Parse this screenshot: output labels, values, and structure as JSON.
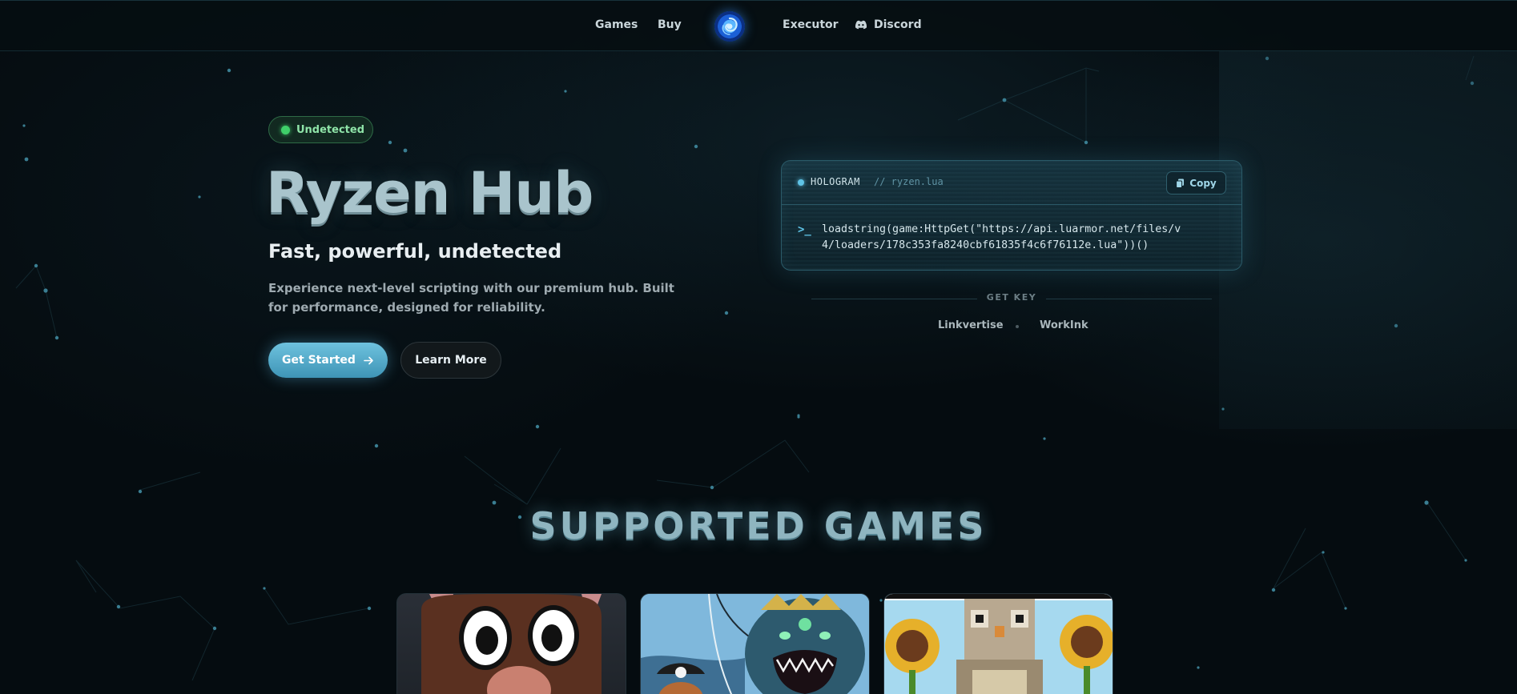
{
  "nav": {
    "games": "Games",
    "buy": "Buy",
    "executor": "Executor",
    "discord": "Discord",
    "logo_icon": "ryzen-swirl-logo"
  },
  "hero": {
    "badge": "Undetected",
    "title": "Ryzen Hub",
    "subtitle": "Fast, powerful, undetected",
    "description": "Experience next-level scripting with our premium hub. Built for performance, designed for reliability.",
    "primary_button": "Get Started",
    "secondary_button": "Learn More"
  },
  "code": {
    "tag": "HOLOGRAM",
    "file": "// ryzen.lua",
    "copy": "Copy",
    "prompt": ">_",
    "line1": "loadstring(game:HttpGet(\"https://api.luarmor.net/files/v",
    "line2": "4/loaders/178c353fa8240cbf61835f4c6f76112e.lua\"))()"
  },
  "getkey": {
    "label": "GET KEY",
    "links": [
      "Linkvertise",
      "WorkInk"
    ]
  },
  "games": {
    "title": "SUPPORTED GAMES",
    "cards": [
      {
        "image": "cartoon-moose-face-thumbnail"
      },
      {
        "image": "pirate-sea-monster-thumbnail"
      },
      {
        "image": "sunflower-owl-blocks-thumbnail"
      }
    ]
  },
  "colors": {
    "accent": "#5fc3e6",
    "badge_green": "#3fcf6a",
    "background": "#050c10"
  }
}
